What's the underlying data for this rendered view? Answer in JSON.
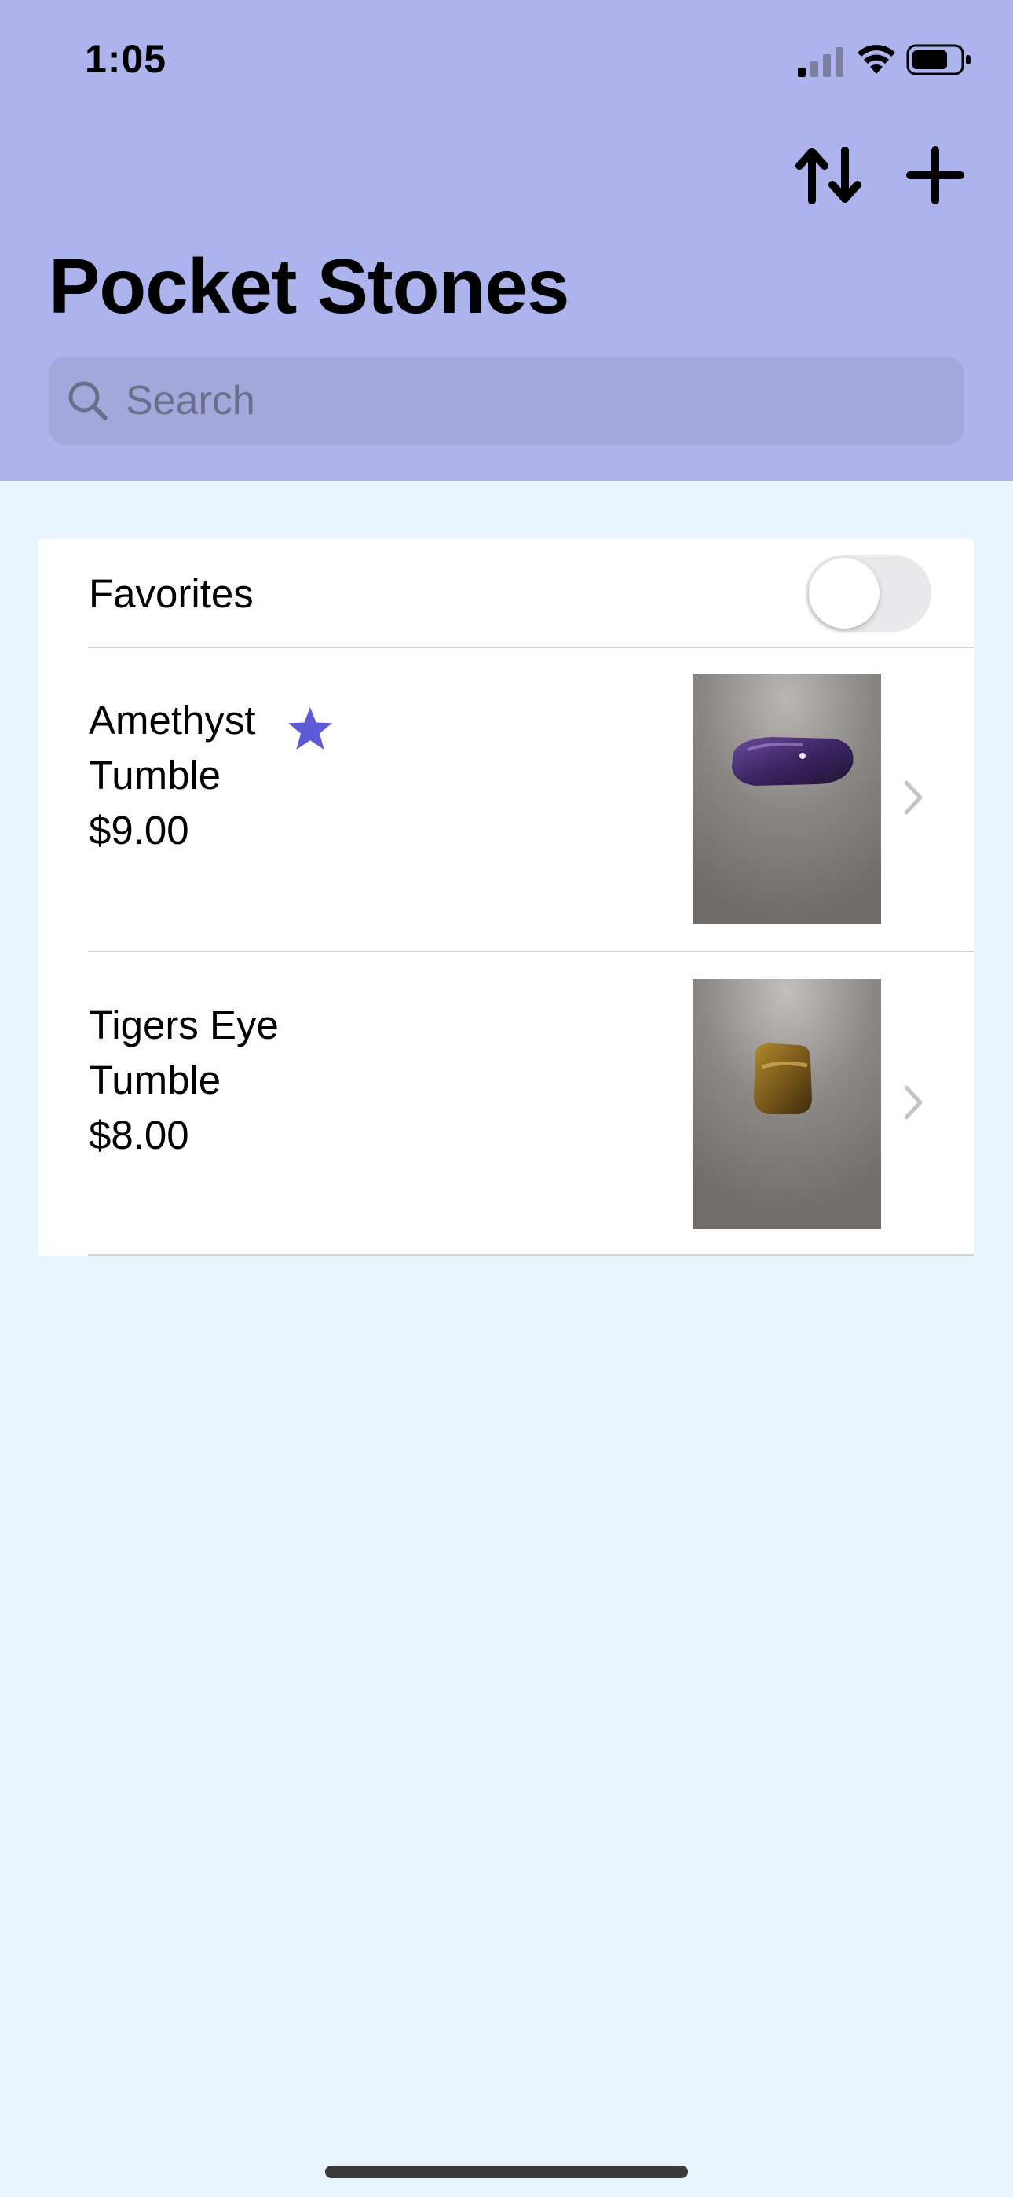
{
  "status_bar": {
    "time": "1:05"
  },
  "toolbar": {
    "sort_icon": "arrow-up-down-icon",
    "add_icon": "plus-icon"
  },
  "nav": {
    "title": "Pocket Stones"
  },
  "search": {
    "placeholder": "Search",
    "value": ""
  },
  "favorites": {
    "label": "Favorites",
    "enabled": false
  },
  "stones": [
    {
      "name_line1": "Amethyst",
      "name_line2": "Tumble",
      "price": "$9.00",
      "favorite": true,
      "image": "purple stone photo"
    },
    {
      "name_line1": "Tigers Eye",
      "name_line2": "Tumble",
      "price": "$8.00",
      "favorite": false,
      "image": "tiger eye stone photo"
    }
  ],
  "colors": {
    "header_bg": "#adb3ec",
    "body_bg": "#e8f4fc",
    "accent_star": "#5b5bd6"
  }
}
